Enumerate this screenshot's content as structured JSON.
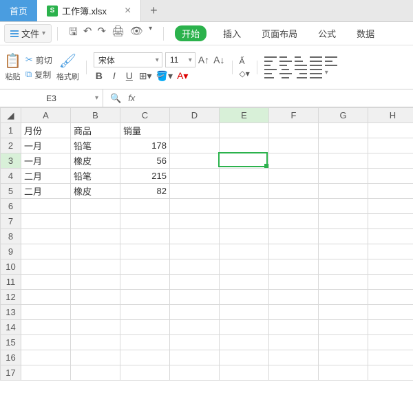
{
  "tabs": {
    "home": "首页",
    "doc": "工作簿.xlsx",
    "docIconLetter": "S"
  },
  "file_menu": "文件",
  "ribbon_tabs": {
    "start": "开始",
    "insert": "插入",
    "layout": "页面布局",
    "formula": "公式",
    "data": "数据"
  },
  "clipboard": {
    "paste": "粘贴",
    "cut": "剪切",
    "copy": "复制",
    "format_painter": "格式刷"
  },
  "font": {
    "name": "宋体",
    "size": "11"
  },
  "namebox": "E3",
  "fx_label": "fx",
  "columns": [
    "A",
    "B",
    "C",
    "D",
    "E",
    "F",
    "G",
    "H"
  ],
  "rows_shown": 17,
  "selected": {
    "row": 3,
    "col": 5
  },
  "data": {
    "headers": [
      "月份",
      "商品",
      "销量"
    ],
    "rows": [
      [
        "一月",
        "铅笔",
        178
      ],
      [
        "一月",
        "橡皮",
        56
      ],
      [
        "二月",
        "铅笔",
        215
      ],
      [
        "二月",
        "橡皮",
        82
      ]
    ]
  }
}
